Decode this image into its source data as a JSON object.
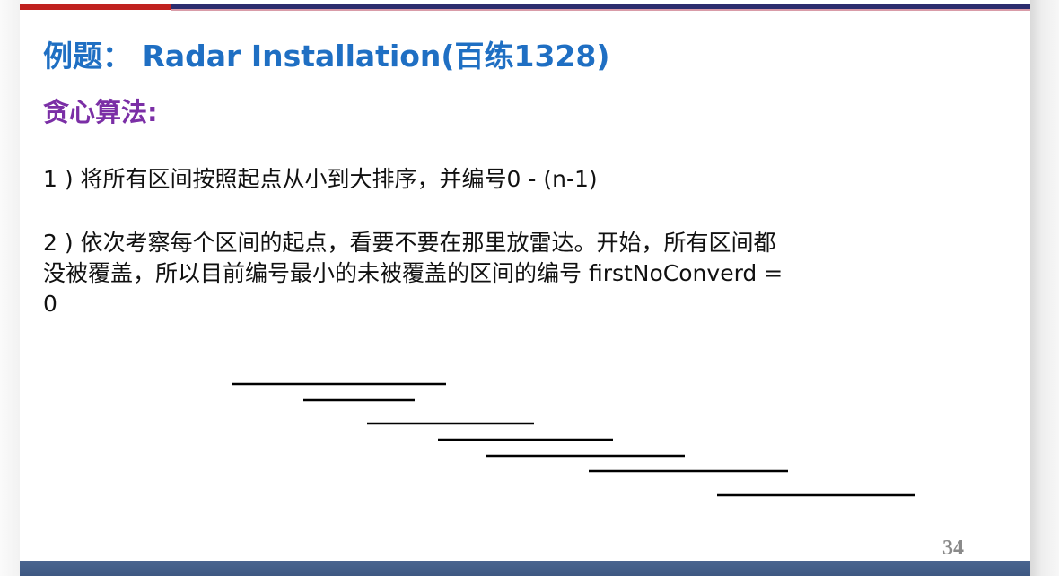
{
  "slide": {
    "title": "例题：  Radar Installation(百练1328)",
    "subtitle": "贪心算法:",
    "steps": [
      {
        "lines": [
          "1 ) 将所有区间按照起点从小到大排序，并编号0 - (n-1)"
        ]
      },
      {
        "lines": [
          "2 ) 依次考察每个区间的起点，看要不要在那里放雷达。开始，所有区间都",
          "没被覆盖，所以目前编号最小的未被覆盖的区间的编号 firstNoConverd =",
          "0"
        ]
      }
    ],
    "page_number": "34"
  },
  "colors": {
    "title": "#1f6fc3",
    "subtitle": "#7b2fa6",
    "accent_red": "#c0211f",
    "accent_navy": "#2c2d6e",
    "bottom_bar": "#3e5882",
    "interval_lines": "#000000"
  },
  "diagram": {
    "description_visible": "",
    "interval_count": 7
  }
}
